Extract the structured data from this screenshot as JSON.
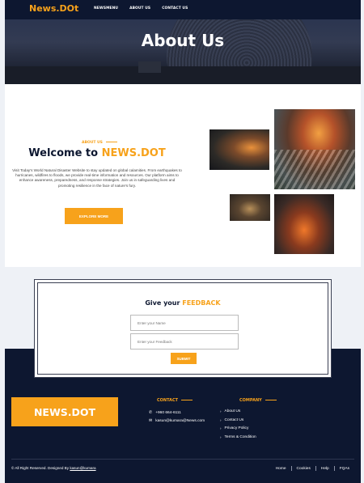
{
  "nav": {
    "brand": "News.DOt",
    "items": [
      "NEWSMENU",
      "ABOUT US",
      "CONTACT US"
    ]
  },
  "hero": {
    "title": "About Us"
  },
  "about": {
    "tag": "ABOUT US",
    "welcome_prefix": "Welcome to ",
    "welcome_accent": "NEWS.DOT",
    "text": "Visit Today's World Natural Disaster Website to stay updated on global calamities. From earthquakes to hurricanes, wildfires to floods, we provide real-time information and resources. Our platform aims to enhance awareness, preparedness, and response strategies. Join us in safeguarding lives and promoting resilience in the face of nature's fury.",
    "button": "EXPLORE MORE"
  },
  "feedback": {
    "title_prefix": "Give your ",
    "title_accent": "FEEDBACK",
    "name_placeholder": "Enter your Name",
    "feedback_placeholder": "Enter your Feedback",
    "submit": "SUBMIT"
  },
  "footer": {
    "logo": "NEWS.DOT",
    "contact_heading": "CONTACT",
    "phone": "+960 664-6111",
    "email": "kasun@kumara@News.com",
    "company_heading": "COMPANY",
    "company_links": [
      "About Us",
      "Contact Us",
      "Privacy Policy",
      "Terms & Condition"
    ],
    "copyright_prefix": "© All Right Reserved. Designed By ",
    "copyright_link": "kasun@kumara",
    "bottom_links": [
      "Home",
      "Cookies",
      "Help",
      "FQAs"
    ]
  },
  "colors": {
    "accent": "#f7a21b",
    "navy": "#0d1730"
  },
  "icons": {
    "phone": "phone-icon",
    "email": "email-icon",
    "chevron": "chevron-right-icon"
  }
}
